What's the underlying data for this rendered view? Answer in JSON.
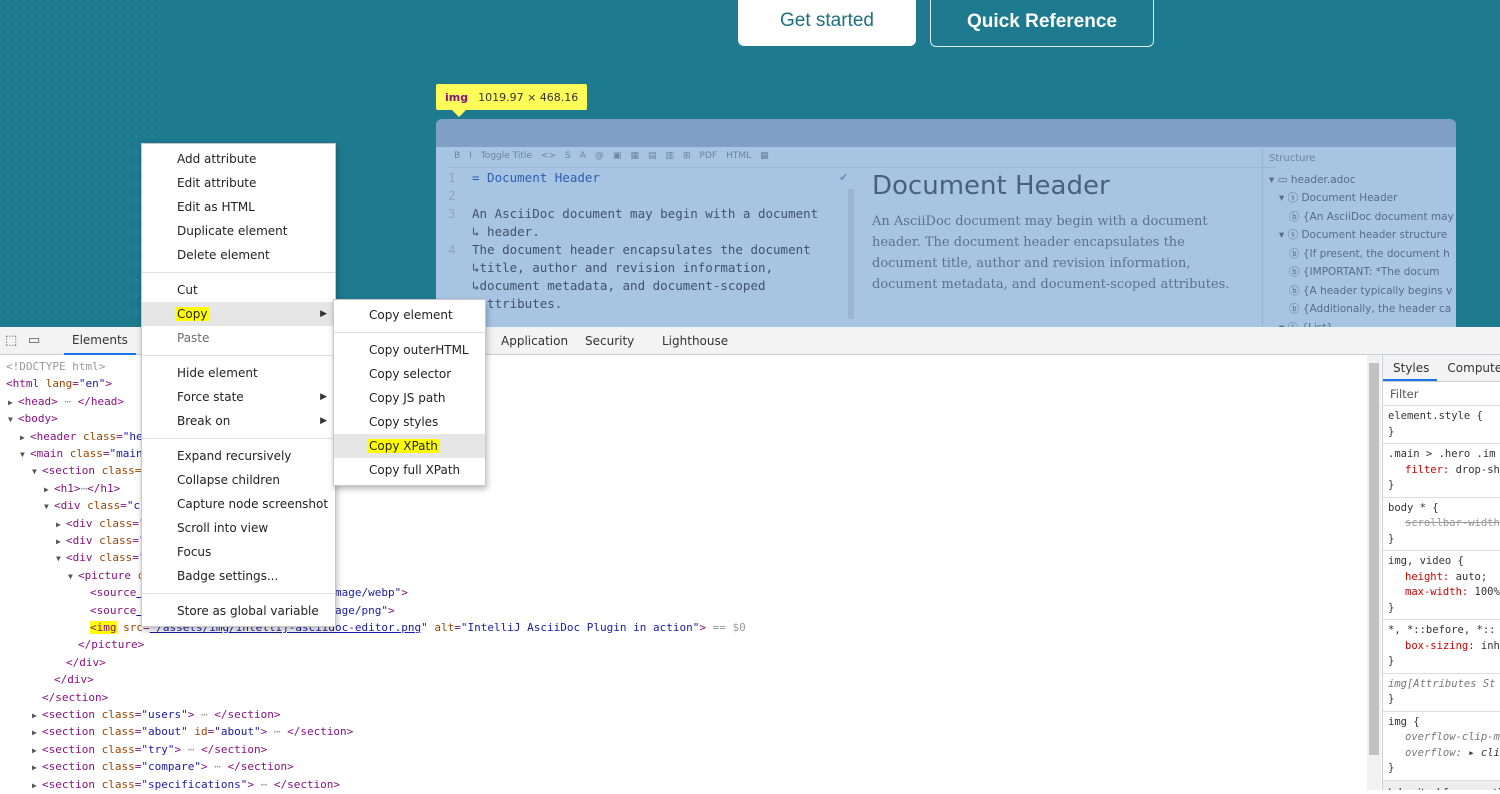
{
  "hero": {
    "get_started": "Get started",
    "quick_reference": "Quick Reference"
  },
  "tooltip": {
    "tag": "img",
    "size": "1019.97 × 468.16"
  },
  "editor": {
    "toolbar": [
      "B",
      "I",
      "Toggle Title",
      "<>",
      "S",
      "A",
      "@",
      "▣",
      "▦",
      "▤",
      "▥",
      "⊞",
      "PDF",
      "HTML",
      "▦"
    ],
    "lines": [
      {
        "n": "1",
        "t": "= Document Header"
      },
      {
        "n": "2",
        "t": ""
      },
      {
        "n": "3",
        "t": "An AsciiDoc document may begin with a document"
      },
      {
        "n": "",
        "t": "↳ header."
      },
      {
        "n": "4",
        "t": "The document header encapsulates the document"
      },
      {
        "n": "",
        "t": "↳title, author and revision information,"
      },
      {
        "n": "",
        "t": "↳document metadata, and document-scoped"
      },
      {
        "n": "",
        "t": "↳attributes."
      }
    ],
    "preview_title": "Document Header",
    "preview_text": "An AsciiDoc document may begin with a document header. The document header encapsulates the document title, author and revision information, document metadata, and document-scoped attributes.",
    "structure_title": "Structure",
    "structure": [
      "▾ ▭ header.adoc",
      "   ▾ ⓢ Document Header",
      "      ⓑ {An AsciiDoc document may",
      "   ▾ ⓢ Document header structure",
      "      ⓑ {If present, the document h",
      "      ⓑ {IMPORTANT: *The docum",
      "      ⓑ {A header typically begins v",
      "      ⓑ {Additionally, the header ca",
      "   ▾ ⓛ {List}"
    ]
  },
  "devtools": {
    "tabs": [
      "Elements",
      "Application",
      "Security",
      "Lighthouse"
    ]
  },
  "dom": [
    {
      "tok": [
        [
          "cm",
          "<!DOCTYPE html>"
        ]
      ]
    },
    {
      "tok": [
        [
          "tg",
          "<html "
        ],
        [
          "at",
          "lang"
        ],
        [
          "tg",
          "="
        ],
        [
          "av",
          "\"en\""
        ],
        [
          "tg",
          ">"
        ]
      ]
    },
    {
      "tok": [
        [
          "tri",
          "▶"
        ],
        [
          "tg",
          "<head>"
        ],
        [
          "cm",
          " ⋯ "
        ],
        [
          "tg",
          "</head>"
        ]
      ]
    },
    {
      "tok": [
        [
          "tri",
          "▼"
        ],
        [
          "tg",
          "<body>"
        ]
      ]
    },
    {
      "tok": [
        [
          "tri",
          "▶"
        ],
        [
          "tg",
          "<header "
        ],
        [
          "at",
          "class"
        ],
        [
          "tg",
          "="
        ],
        [
          "av",
          "\"he"
        ]
      ]
    },
    {
      "tok": [
        [
          "tri",
          "▼"
        ],
        [
          "tg",
          "<main "
        ],
        [
          "at",
          "class"
        ],
        [
          "tg",
          "="
        ],
        [
          "av",
          "\"main"
        ]
      ]
    },
    {
      "tok": [
        [
          "tri",
          "▼"
        ],
        [
          "tg",
          "<section "
        ],
        [
          "at",
          "class="
        ]
      ]
    },
    {
      "tok": [
        [
          "tri",
          "▶"
        ],
        [
          "tg",
          "<h1>"
        ],
        [
          "cm",
          "⋯"
        ],
        [
          "tg",
          "</h1>"
        ]
      ]
    },
    {
      "tok": [
        [
          "tri",
          "▼"
        ],
        [
          "tg",
          "<div "
        ],
        [
          "at",
          "class"
        ],
        [
          "tg",
          "="
        ],
        [
          "av",
          "\"c"
        ]
      ]
    },
    {
      "tok": [
        [
          "tri",
          "▶"
        ],
        [
          "tg",
          "<div "
        ],
        [
          "at",
          "class"
        ],
        [
          "tg",
          "="
        ],
        [
          "av",
          "\""
        ]
      ]
    },
    {
      "tok": [
        [
          "tri",
          "▶"
        ],
        [
          "tg",
          "<div "
        ],
        [
          "at",
          "class"
        ],
        [
          "tg",
          "="
        ],
        [
          "av",
          "\""
        ]
      ]
    },
    {
      "tok": [
        [
          "tri",
          "▼"
        ],
        [
          "tg",
          "<div "
        ],
        [
          "at",
          "class"
        ],
        [
          "tg",
          "="
        ],
        [
          "av",
          "\""
        ]
      ]
    },
    {
      "tok": [
        [
          "tri",
          "▼"
        ],
        [
          "tg",
          "<picture "
        ],
        [
          "at",
          "c"
        ]
      ]
    },
    {
      "tok": [
        [
          "tg",
          "<source"
        ],
        [
          "lk",
          "                   asciidoc-editor.webp"
        ],
        [
          "av",
          "\" "
        ],
        [
          "at",
          "type"
        ],
        [
          "tg",
          "="
        ],
        [
          "av",
          "\"image/webp\""
        ],
        [
          "tg",
          ">"
        ]
      ]
    },
    {
      "tok": [
        [
          "tg",
          "<source"
        ],
        [
          "lk",
          "                   asciidoc-editor.png"
        ],
        [
          "av",
          "\" "
        ],
        [
          "at",
          "type"
        ],
        [
          "tg",
          "="
        ],
        [
          "av",
          "\"image/png\""
        ],
        [
          "tg",
          ">"
        ]
      ]
    },
    {
      "tok": [
        [
          "tg",
          "<img"
        ],
        [
          "at",
          " src"
        ],
        [
          "tg",
          "="
        ],
        [
          "lk",
          "\"/assets/img/intellij-asciidoc-editor.png"
        ],
        [
          "av",
          "\" "
        ],
        [
          "at",
          "alt"
        ],
        [
          "tg",
          "="
        ],
        [
          "av",
          "\"IntelliJ AsciiDoc Plugin in action\""
        ],
        [
          "tg",
          ">"
        ],
        [
          "cm",
          " == $0"
        ]
      ]
    },
    {
      "tok": [
        [
          "tg",
          "</picture>"
        ]
      ]
    },
    {
      "tok": [
        [
          "tg",
          "</div>"
        ]
      ]
    },
    {
      "tok": [
        [
          "tg",
          "</div>"
        ]
      ]
    },
    {
      "tok": [
        [
          "tg",
          "</section>"
        ]
      ]
    },
    {
      "tok": [
        [
          "tri",
          "▶"
        ],
        [
          "tg",
          "<section "
        ],
        [
          "at",
          "class"
        ],
        [
          "tg",
          "="
        ],
        [
          "av",
          "\"users\""
        ],
        [
          "tg",
          ">"
        ],
        [
          "cm",
          " ⋯ "
        ],
        [
          "tg",
          "</section>"
        ]
      ]
    },
    {
      "tok": [
        [
          "tri",
          "▶"
        ],
        [
          "tg",
          "<section "
        ],
        [
          "at",
          "class"
        ],
        [
          "tg",
          "="
        ],
        [
          "av",
          "\"about\" "
        ],
        [
          "at",
          "id"
        ],
        [
          "tg",
          "="
        ],
        [
          "av",
          "\"about\""
        ],
        [
          "tg",
          ">"
        ],
        [
          "cm",
          " ⋯ "
        ],
        [
          "tg",
          "</section>"
        ]
      ]
    },
    {
      "tok": [
        [
          "tri",
          "▶"
        ],
        [
          "tg",
          "<section "
        ],
        [
          "at",
          "class"
        ],
        [
          "tg",
          "="
        ],
        [
          "av",
          "\"try\""
        ],
        [
          "tg",
          ">"
        ],
        [
          "cm",
          " ⋯ "
        ],
        [
          "tg",
          "</section>"
        ]
      ]
    },
    {
      "tok": [
        [
          "tri",
          "▶"
        ],
        [
          "tg",
          "<section "
        ],
        [
          "at",
          "class"
        ],
        [
          "tg",
          "="
        ],
        [
          "av",
          "\"compare\""
        ],
        [
          "tg",
          ">"
        ],
        [
          "cm",
          " ⋯ "
        ],
        [
          "tg",
          "</section>"
        ]
      ]
    },
    {
      "tok": [
        [
          "tri",
          "▶"
        ],
        [
          "tg",
          "<section "
        ],
        [
          "at",
          "class"
        ],
        [
          "tg",
          "="
        ],
        [
          "av",
          "\"specifications\""
        ],
        [
          "tg",
          ">"
        ],
        [
          "cm",
          " ⋯ "
        ],
        [
          "tg",
          "</section>"
        ]
      ]
    }
  ],
  "styles_panel": {
    "tabs": [
      "Styles",
      "Computed"
    ],
    "filter": "Filter",
    "rules": [
      {
        "sel": "element.style {",
        "props": [],
        "close": "}"
      },
      {
        "sel": ".main > .hero .im",
        "props": [
          [
            "filter:",
            "drop-sh"
          ]
        ],
        "close": "}"
      },
      {
        "sel": "body * {",
        "props": [
          [
            "scrollbar-width",
            "",
            true
          ]
        ],
        "close": "}"
      },
      {
        "sel": "img, video {",
        "props": [
          [
            "height:",
            "auto;"
          ],
          [
            "max-width:",
            "100%"
          ]
        ],
        "close": "}"
      },
      {
        "sel": "*, *::before, *::",
        "props": [
          [
            "box-sizing:",
            "inh"
          ]
        ],
        "close": "}"
      },
      {
        "sel": "img[Attributes St",
        "props": [],
        "close": "}",
        "ital": true
      },
      {
        "sel": "img {",
        "props": [
          [
            "overflow-clip-m",
            ""
          ],
          [
            "overflow:",
            "▸ cli"
          ]
        ],
        "close": "}",
        "ital_props": true
      }
    ],
    "inherited": "Inherited from  secti"
  },
  "context_menu": {
    "groups": [
      [
        "Add attribute",
        "Edit attribute",
        "Edit as HTML",
        "Duplicate element",
        "Delete element"
      ],
      [
        "Cut",
        "Copy",
        "Paste"
      ],
      [
        "Hide element",
        "Force state",
        "Break on"
      ],
      [
        "Expand recursively",
        "Collapse children",
        "Capture node screenshot",
        "Scroll into view",
        "Focus",
        "Badge settings..."
      ],
      [
        "Store as global variable"
      ]
    ]
  },
  "copy_submenu": {
    "groups": [
      [
        "Copy element"
      ],
      [
        "Copy outerHTML",
        "Copy selector",
        "Copy JS path",
        "Copy styles",
        "Copy XPath",
        "Copy full XPath"
      ]
    ]
  },
  "highlight_color": "#ffff00",
  "brand_color": "#1e7b8f"
}
